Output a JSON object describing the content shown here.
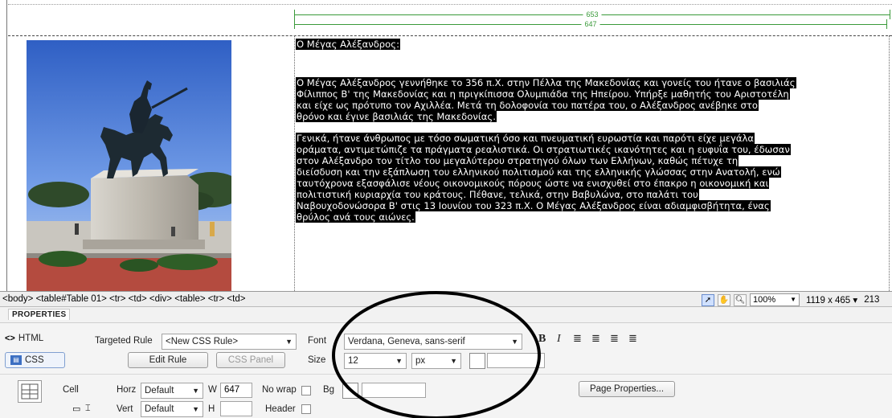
{
  "ruler": {
    "outer_width": "653",
    "inner_width": "647"
  },
  "photo": {
    "alt": "Statue of Alexander the Great on horseback"
  },
  "content": {
    "heading": "Ο Μέγας Αλέξανδρος:",
    "paragraph1": [
      "Ο Μέγας Αλέξανδρος γεννήθηκε το 356 π.Χ. στην Πέλλα της Μακεδονίας και γονείς του ήτανε ο βασιλιάς",
      "Φίλιππος Β' της Μακεδονίας και η πριγκίπισσα Ολυμπιάδα της Ηπείρου. Υπήρξε μαθητής του Αριστοτέλη",
      "και είχε ως πρότυπο τον Αχιλλέα. Μετά τη δολοφονία του πατέρα του, ο Αλέξανδρος ανέβηκε στο",
      "θρόνο και έγινε βασιλιάς της Μακεδονίας."
    ],
    "paragraph2": [
      "Γενικά, ήτανε άνθρωπος με τόσο σωματική όσο και πνευματική ευρωστία και παρότι είχε μεγάλα",
      "οράματα, αντιμετώπιζε τα πράγματα ρεαλιστικά. Οι στρατιωτικές ικανότητες και η ευφυΐα του, έδωσαν",
      "στον Αλέξανδρο τον τίτλο του μεγαλύτερου στρατηγού όλων των Ελλήνων, καθώς πέτυχε τη",
      "διείσδυση και την εξάπλωση του ελληνικού πολιτισμού και της ελληνικής γλώσσας στην Ανατολή, ενώ",
      "ταυτόχρονα εξασφάλισε νέους οικονομικούς πόρους ώστε να ενισχυθεί στο έπακρο η οικονομική και",
      "πολιτιστική κυριαρχία του κράτους. Πέθανε, τελικά, στην Βαβυλώνα, στο παλάτι του",
      "Ναβουχοδονώσορα Β' στις 13 Ιουνίου του 323 π.Χ. Ο Μέγας Αλέξανδρος είναι αδιαμφισβήτητα, ένας",
      "θρύλος ανά τους αιώνες."
    ]
  },
  "status": {
    "tag_path": "<body> <table#Table 01> <tr> <td> <div> <table> <tr> <td>",
    "zoom": "100%",
    "dimensions": "1119 x 465",
    "dimensions_arrow": "▾",
    "extra": "213"
  },
  "properties": {
    "title": "PROPERTIES",
    "html_tab": "HTML",
    "css_tab": "CSS",
    "targeted_rule_label": "Targeted Rule",
    "targeted_rule_value": "<New CSS Rule>",
    "edit_rule": "Edit Rule",
    "css_panel": "CSS Panel",
    "font_label": "Font",
    "font_value": "Verdana, Geneva, sans-serif",
    "size_label": "Size",
    "size_value": "12",
    "size_unit": "px",
    "bold": "B",
    "italic": "I",
    "cell_label": "Cell",
    "horz_label": "Horz",
    "horz_value": "Default",
    "vert_label": "Vert",
    "vert_value": "Default",
    "w_label": "W",
    "w_value": "647",
    "h_label": "H",
    "h_value": "",
    "nowrap_label": "No wrap",
    "header_label": "Header",
    "bg_label": "Bg",
    "page_properties": "Page Properties..."
  },
  "colors": {
    "ruler_green": "#3a9a3a",
    "selection_bg": "#000000",
    "panel_bg": "#f4f4f4"
  }
}
